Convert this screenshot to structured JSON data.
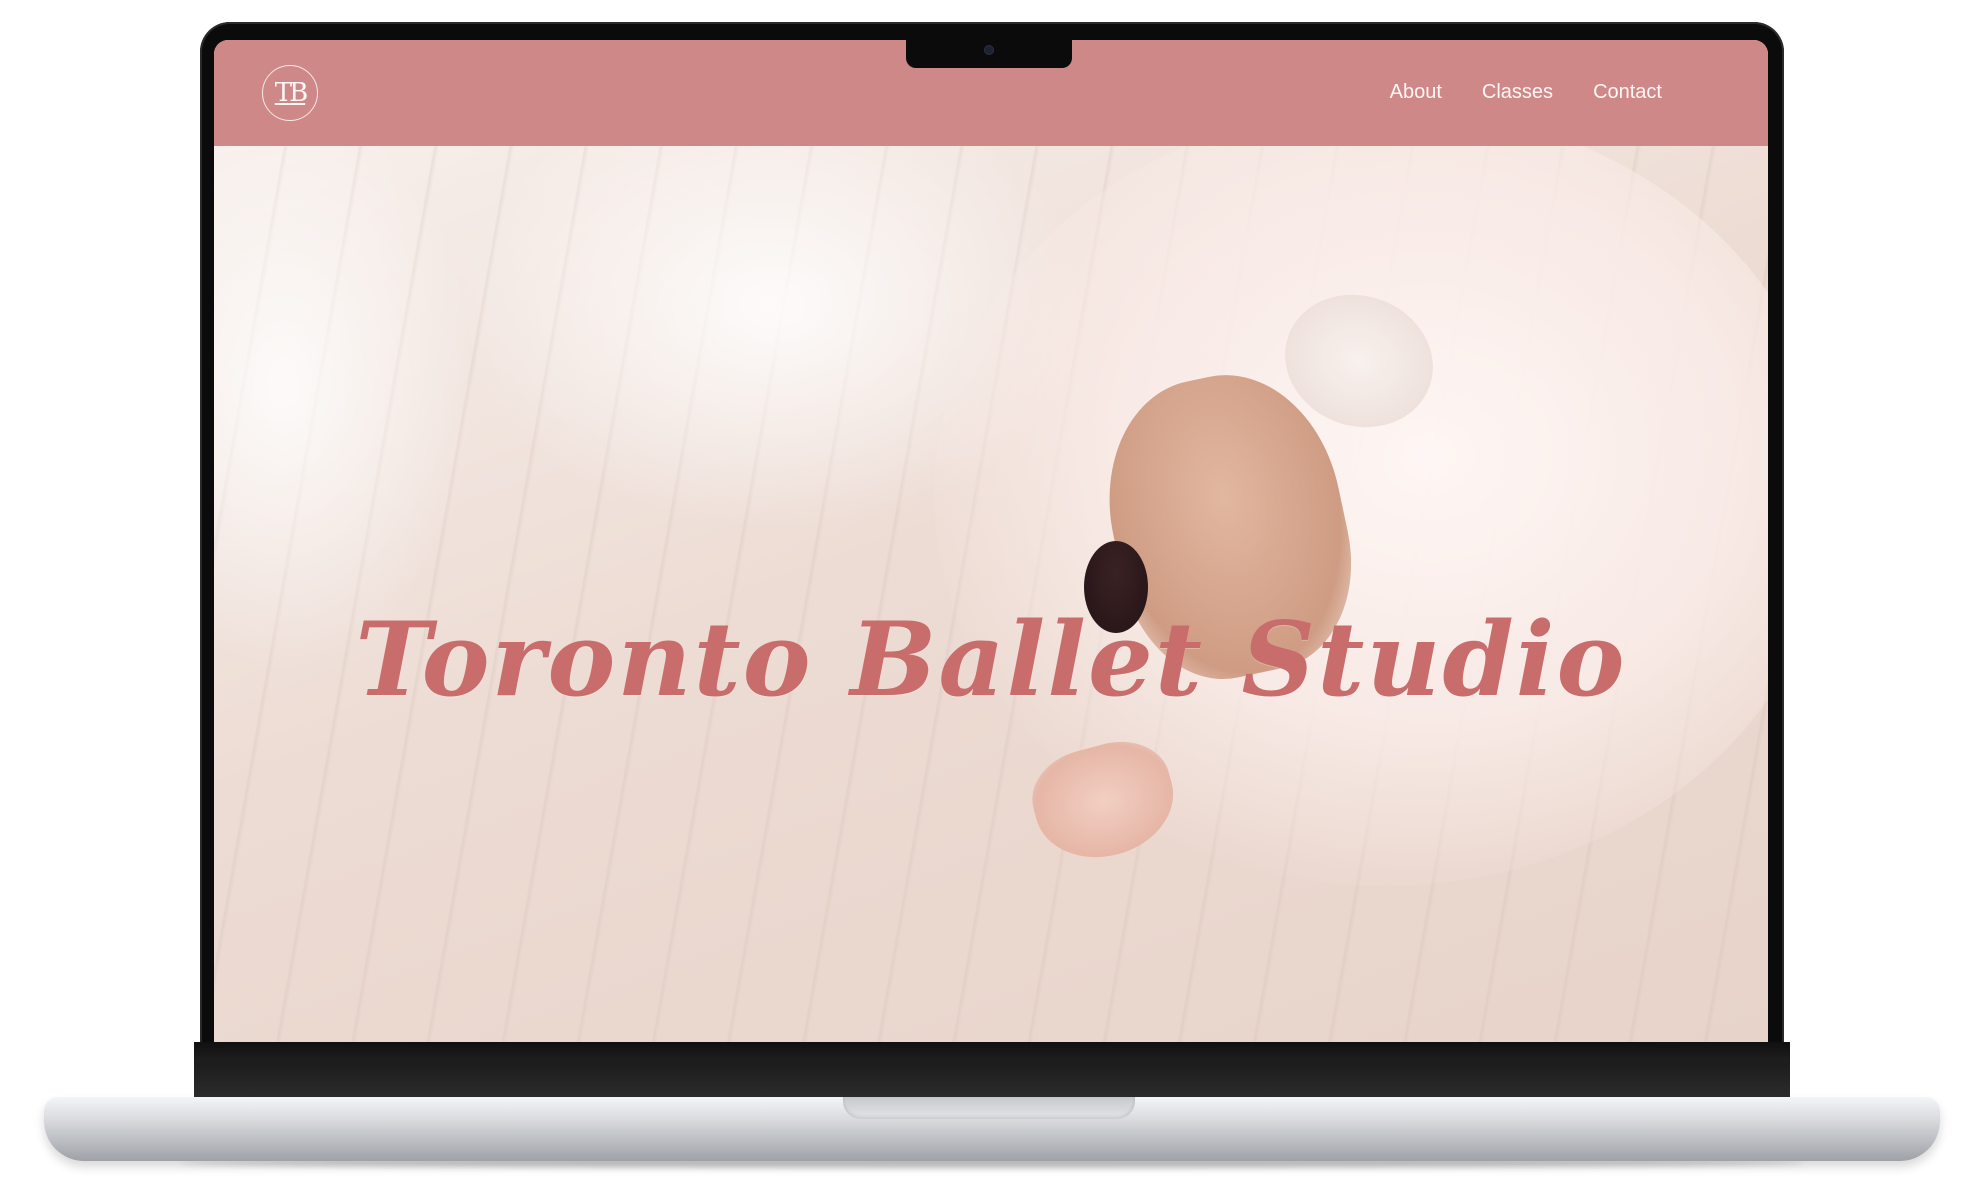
{
  "site": {
    "logo_text": "TB",
    "nav": [
      {
        "label": "About"
      },
      {
        "label": "Classes"
      },
      {
        "label": "Contact"
      }
    ]
  },
  "hero": {
    "title": "Toronto Ballet Studio",
    "image": "ballerina-stretching-on-wood-floor"
  },
  "colors": {
    "header_bg": "#cf8888",
    "title_color": "#c96c6c",
    "nav_text": "#fff6f6"
  }
}
